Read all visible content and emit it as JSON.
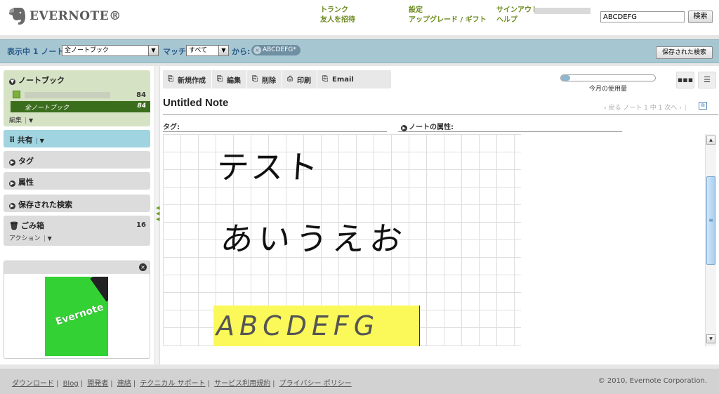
{
  "brand": {
    "name": "EVERNOTE®"
  },
  "header": {
    "links": [
      {
        "label": "トランク"
      },
      {
        "label": "友人を招待"
      },
      {
        "label": "設定"
      },
      {
        "label": "アップグレード / ギフト"
      },
      {
        "label": "サインアウト"
      },
      {
        "label": "ヘルプ"
      }
    ],
    "search_value": "ABCDEFG",
    "search_button": "検索"
  },
  "filterbar": {
    "showing_label": "表示中 1 ノート",
    "notebook_select": "全ノートブック",
    "match_label": "マッチ",
    "match_select": "すべて",
    "from_label": "から:",
    "tag_chip": "ABCDEFG*",
    "saved_search_button": "保存された検索"
  },
  "sidebar": {
    "notebooks": {
      "title": "ノートブック",
      "items": [
        {
          "label": "",
          "count": "84"
        },
        {
          "label": "全ノートブック",
          "count": "84"
        }
      ],
      "edit_label": "編集"
    },
    "shared": {
      "title": "共有"
    },
    "tags": {
      "title": "タグ"
    },
    "attributes": {
      "title": "属性"
    },
    "saved_searches": {
      "title": "保存された検索"
    },
    "trash": {
      "title": "ごみ箱",
      "count": "16",
      "action_label": "アクション"
    }
  },
  "promo": {
    "book_title": "Evernote"
  },
  "toolbar": {
    "new_label": "新規作成",
    "edit_label": "編集",
    "delete_label": "削除",
    "print_label": "印刷",
    "email_label": "Email"
  },
  "usage": {
    "label": "今月の使用量",
    "fraction": 0.1
  },
  "note": {
    "title": "Untitled Note",
    "nav_text": "‹ 戻る ノート 1 中 1 次へ ›",
    "tags_label": "タグ:",
    "attributes_label": "ノートの属性:",
    "handwriting": [
      "テスト",
      "あいうえお",
      "ABCDEFG"
    ]
  },
  "footer": {
    "links": [
      "ダウンロード",
      "Blog",
      "開発者",
      "連絡",
      "テクニカル サポート",
      "サービス利用規約",
      "プライバシー ポリシー"
    ],
    "copyright": "© 2010, Evernote Corporation."
  }
}
